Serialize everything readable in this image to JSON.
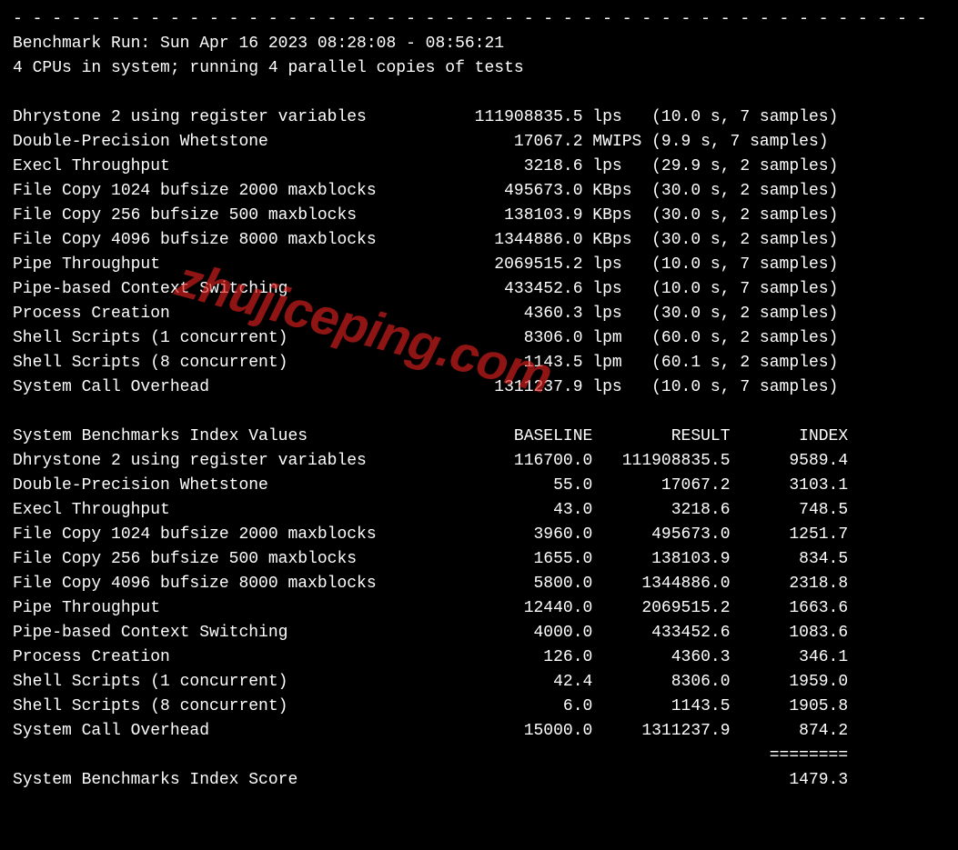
{
  "dashes": "- - - - - - - - - - - - - - - - - - - - - - - - - - - - - - - - - - - - - - - - - - - - - - -",
  "run_info": "Benchmark Run: Sun Apr 16 2023 08:28:08 - 08:56:21",
  "cpu_info": "4 CPUs in system; running 4 parallel copies of tests",
  "tests": [
    {
      "name": "Dhrystone 2 using register variables",
      "value": "111908835.5",
      "unit": "lps",
      "timing": "(10.0 s, 7 samples)"
    },
    {
      "name": "Double-Precision Whetstone",
      "value": "17067.2",
      "unit": "MWIPS",
      "timing": "(9.9 s, 7 samples)"
    },
    {
      "name": "Execl Throughput",
      "value": "3218.6",
      "unit": "lps",
      "timing": "(29.9 s, 2 samples)"
    },
    {
      "name": "File Copy 1024 bufsize 2000 maxblocks",
      "value": "495673.0",
      "unit": "KBps",
      "timing": "(30.0 s, 2 samples)"
    },
    {
      "name": "File Copy 256 bufsize 500 maxblocks",
      "value": "138103.9",
      "unit": "KBps",
      "timing": "(30.0 s, 2 samples)"
    },
    {
      "name": "File Copy 4096 bufsize 8000 maxblocks",
      "value": "1344886.0",
      "unit": "KBps",
      "timing": "(30.0 s, 2 samples)"
    },
    {
      "name": "Pipe Throughput",
      "value": "2069515.2",
      "unit": "lps",
      "timing": "(10.0 s, 7 samples)"
    },
    {
      "name": "Pipe-based Context Switching",
      "value": "433452.6",
      "unit": "lps",
      "timing": "(10.0 s, 7 samples)"
    },
    {
      "name": "Process Creation",
      "value": "4360.3",
      "unit": "lps",
      "timing": "(30.0 s, 2 samples)"
    },
    {
      "name": "Shell Scripts (1 concurrent)",
      "value": "8306.0",
      "unit": "lpm",
      "timing": "(60.0 s, 2 samples)"
    },
    {
      "name": "Shell Scripts (8 concurrent)",
      "value": "1143.5",
      "unit": "lpm",
      "timing": "(60.1 s, 2 samples)"
    },
    {
      "name": "System Call Overhead",
      "value": "1311237.9",
      "unit": "lps",
      "timing": "(10.0 s, 7 samples)"
    }
  ],
  "index_header": {
    "label": "System Benchmarks Index Values",
    "baseline": "BASELINE",
    "result": "RESULT",
    "index": "INDEX"
  },
  "index_rows": [
    {
      "name": "Dhrystone 2 using register variables",
      "baseline": "116700.0",
      "result": "111908835.5",
      "index": "9589.4"
    },
    {
      "name": "Double-Precision Whetstone",
      "baseline": "55.0",
      "result": "17067.2",
      "index": "3103.1"
    },
    {
      "name": "Execl Throughput",
      "baseline": "43.0",
      "result": "3218.6",
      "index": "748.5"
    },
    {
      "name": "File Copy 1024 bufsize 2000 maxblocks",
      "baseline": "3960.0",
      "result": "495673.0",
      "index": "1251.7"
    },
    {
      "name": "File Copy 256 bufsize 500 maxblocks",
      "baseline": "1655.0",
      "result": "138103.9",
      "index": "834.5"
    },
    {
      "name": "File Copy 4096 bufsize 8000 maxblocks",
      "baseline": "5800.0",
      "result": "1344886.0",
      "index": "2318.8"
    },
    {
      "name": "Pipe Throughput",
      "baseline": "12440.0",
      "result": "2069515.2",
      "index": "1663.6"
    },
    {
      "name": "Pipe-based Context Switching",
      "baseline": "4000.0",
      "result": "433452.6",
      "index": "1083.6"
    },
    {
      "name": "Process Creation",
      "baseline": "126.0",
      "result": "4360.3",
      "index": "346.1"
    },
    {
      "name": "Shell Scripts (1 concurrent)",
      "baseline": "42.4",
      "result": "8306.0",
      "index": "1959.0"
    },
    {
      "name": "Shell Scripts (8 concurrent)",
      "baseline": "6.0",
      "result": "1143.5",
      "index": "1905.8"
    },
    {
      "name": "System Call Overhead",
      "baseline": "15000.0",
      "result": "1311237.9",
      "index": "874.2"
    }
  ],
  "score_divider": "                                                                             ========",
  "score": {
    "label": "System Benchmarks Index Score",
    "value": "1479.3"
  },
  "watermark": "zhujiceping.com"
}
